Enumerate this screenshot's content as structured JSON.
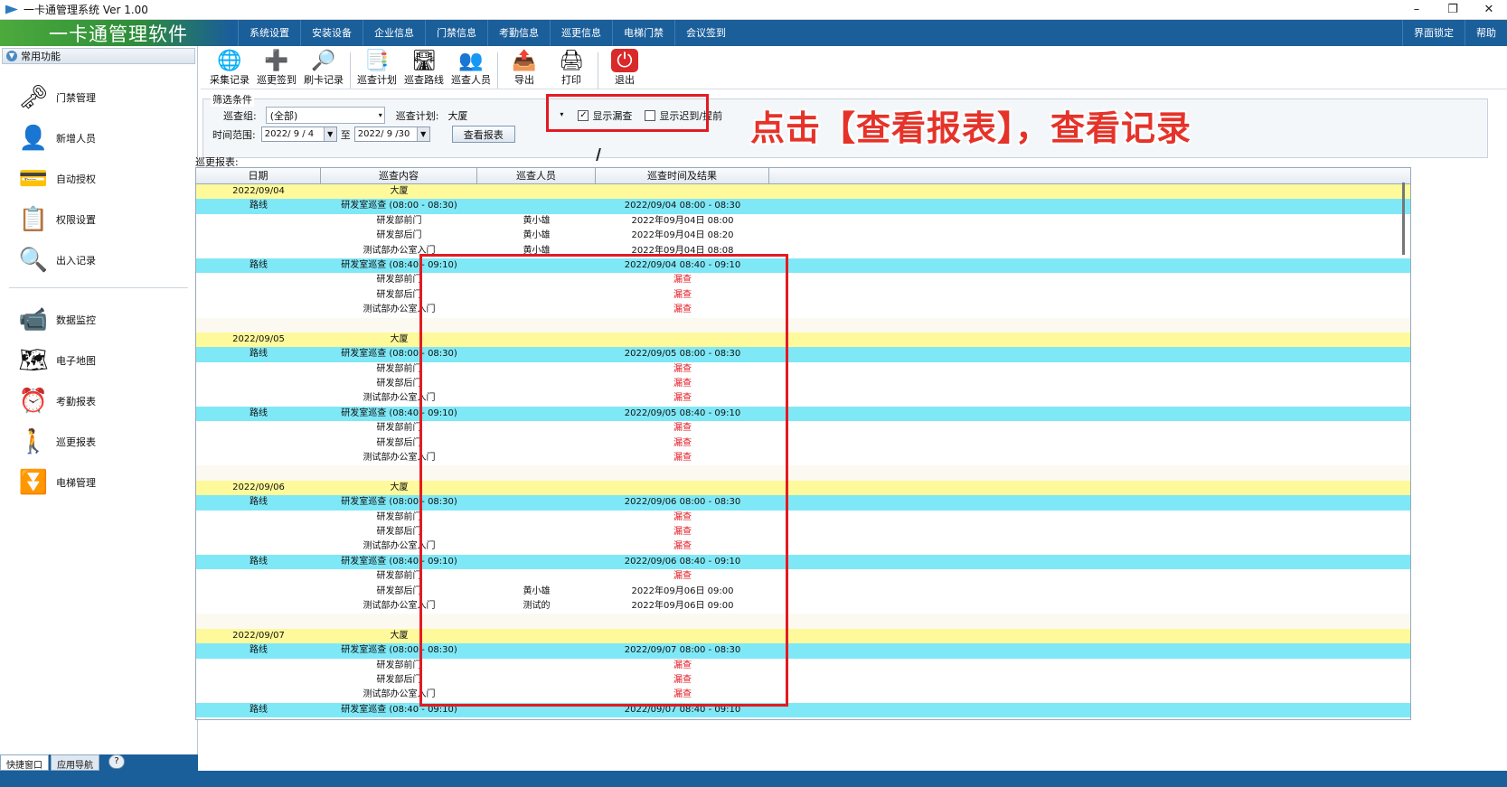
{
  "window": {
    "title": "一卡通管理系统  Ver 1.00",
    "controls": [
      "–",
      "❐",
      "✕"
    ]
  },
  "brand": "一卡通管理软件",
  "menu": [
    "系统设置",
    "安装设备",
    "企业信息",
    "门禁信息",
    "考勤信息",
    "巡更信息",
    "电梯门禁",
    "会议签到"
  ],
  "menu_right": [
    "界面锁定",
    "帮助"
  ],
  "sidebar": {
    "header": "常用功能",
    "group1": [
      {
        "label": "门禁管理",
        "icon": "door-reader-icon"
      },
      {
        "label": "新增人员",
        "icon": "person-icon"
      },
      {
        "label": "自动授权",
        "icon": "card-icon"
      },
      {
        "label": "权限设置",
        "icon": "permission-icon"
      },
      {
        "label": "出入记录",
        "icon": "magnifier-icon"
      }
    ],
    "group2": [
      {
        "label": "数据监控",
        "icon": "camera-icon"
      },
      {
        "label": "电子地图",
        "icon": "map-icon"
      },
      {
        "label": "考勤报表",
        "icon": "clock-icon"
      },
      {
        "label": "巡更报表",
        "icon": "patrol-icon"
      },
      {
        "label": "电梯管理",
        "icon": "elevator-icon"
      }
    ],
    "tabs": [
      "快捷窗口",
      "应用导航"
    ],
    "help": "?"
  },
  "toolbar": [
    {
      "label": "采集记录",
      "icon": "globe-icon"
    },
    {
      "label": "巡更签到",
      "icon": "add-doc-icon"
    },
    {
      "label": "刷卡记录",
      "icon": "search-icon"
    },
    {
      "label": "巡查计划",
      "icon": "plan-icon"
    },
    {
      "label": "巡查路线",
      "icon": "route-icon"
    },
    {
      "label": "巡查人员",
      "icon": "people-icon"
    },
    {
      "label": "导出",
      "icon": "export-icon"
    },
    {
      "label": "打印",
      "icon": "print-icon"
    },
    {
      "label": "退出",
      "icon": "power-icon"
    }
  ],
  "filter": {
    "legend": "筛选条件",
    "group_label": "巡查组:",
    "group_value": "(全部)",
    "plan_label": "巡查计划:",
    "plan_value": "大厦",
    "range_label": "时间范围:",
    "date_from": "2022/ 9 / 4",
    "to": "至",
    "date_to": "2022/ 9 /30",
    "view_button": "查看报表",
    "show_missed": "显示漏查",
    "show_late": "显示迟到/提前"
  },
  "caption": "点击【查看报表】，查看记录",
  "report": {
    "label": "巡更报表:",
    "columns": [
      "日期",
      "巡查内容",
      "巡查人员",
      "巡查时间及结果"
    ],
    "rows": [
      {
        "t": "date",
        "c": [
          "2022/09/04",
          "大厦",
          "",
          ""
        ]
      },
      {
        "t": "route",
        "c": [
          "路线",
          "研发室巡查 (08:00 - 08:30)",
          "",
          "2022/09/04 08:00 - 08:30"
        ]
      },
      {
        "t": "item",
        "c": [
          "",
          "研发部前门",
          "黄小雄",
          "2022年09月04日 08:00"
        ]
      },
      {
        "t": "item",
        "c": [
          "",
          "研发部后门",
          "黄小雄",
          "2022年09月04日 08:20"
        ]
      },
      {
        "t": "item",
        "c": [
          "",
          "测试部办公室入门",
          "黄小雄",
          "2022年09月04日 08:08"
        ]
      },
      {
        "t": "route",
        "c": [
          "路线",
          "研发室巡查 (08:40 - 09:10)",
          "",
          "2022/09/04 08:40 - 09:10"
        ]
      },
      {
        "t": "item",
        "c": [
          "",
          "研发部前门",
          "",
          "漏查"
        ]
      },
      {
        "t": "item",
        "c": [
          "",
          "研发部后门",
          "",
          "漏查"
        ]
      },
      {
        "t": "item",
        "c": [
          "",
          "测试部办公室入门",
          "",
          "漏查"
        ]
      },
      {
        "t": "blank",
        "c": [
          "",
          "",
          "",
          ""
        ]
      },
      {
        "t": "date",
        "c": [
          "2022/09/05",
          "大厦",
          "",
          ""
        ]
      },
      {
        "t": "route",
        "c": [
          "路线",
          "研发室巡查 (08:00 - 08:30)",
          "",
          "2022/09/05 08:00 - 08:30"
        ]
      },
      {
        "t": "item",
        "c": [
          "",
          "研发部前门",
          "",
          "漏查"
        ]
      },
      {
        "t": "item",
        "c": [
          "",
          "研发部后门",
          "",
          "漏查"
        ]
      },
      {
        "t": "item",
        "c": [
          "",
          "测试部办公室入门",
          "",
          "漏查"
        ]
      },
      {
        "t": "route",
        "c": [
          "路线",
          "研发室巡查 (08:40 - 09:10)",
          "",
          "2022/09/05 08:40 - 09:10"
        ]
      },
      {
        "t": "item",
        "c": [
          "",
          "研发部前门",
          "",
          "漏查"
        ]
      },
      {
        "t": "item",
        "c": [
          "",
          "研发部后门",
          "",
          "漏查"
        ]
      },
      {
        "t": "item",
        "c": [
          "",
          "测试部办公室入门",
          "",
          "漏查"
        ]
      },
      {
        "t": "blank",
        "c": [
          "",
          "",
          "",
          ""
        ]
      },
      {
        "t": "date",
        "c": [
          "2022/09/06",
          "大厦",
          "",
          ""
        ]
      },
      {
        "t": "route",
        "c": [
          "路线",
          "研发室巡查 (08:00 - 08:30)",
          "",
          "2022/09/06 08:00 - 08:30"
        ]
      },
      {
        "t": "item",
        "c": [
          "",
          "研发部前门",
          "",
          "漏查"
        ]
      },
      {
        "t": "item",
        "c": [
          "",
          "研发部后门",
          "",
          "漏查"
        ]
      },
      {
        "t": "item",
        "c": [
          "",
          "测试部办公室入门",
          "",
          "漏查"
        ]
      },
      {
        "t": "route",
        "c": [
          "路线",
          "研发室巡查 (08:40 - 09:10)",
          "",
          "2022/09/06 08:40 - 09:10"
        ]
      },
      {
        "t": "item",
        "c": [
          "",
          "研发部前门",
          "",
          "漏查"
        ]
      },
      {
        "t": "item",
        "c": [
          "",
          "研发部后门",
          "黄小雄",
          "2022年09月06日 09:00"
        ]
      },
      {
        "t": "item",
        "c": [
          "",
          "测试部办公室入门",
          "测试的",
          "2022年09月06日 09:00"
        ]
      },
      {
        "t": "blank",
        "c": [
          "",
          "",
          "",
          ""
        ]
      },
      {
        "t": "date",
        "c": [
          "2022/09/07",
          "大厦",
          "",
          ""
        ]
      },
      {
        "t": "route",
        "c": [
          "路线",
          "研发室巡查 (08:00 - 08:30)",
          "",
          "2022/09/07 08:00 - 08:30"
        ]
      },
      {
        "t": "item",
        "c": [
          "",
          "研发部前门",
          "",
          "漏查"
        ]
      },
      {
        "t": "item",
        "c": [
          "",
          "研发部后门",
          "",
          "漏查"
        ]
      },
      {
        "t": "item",
        "c": [
          "",
          "测试部办公室入门",
          "",
          "漏查"
        ]
      },
      {
        "t": "route",
        "c": [
          "路线",
          "研发室巡查 (08:40 - 09:10)",
          "",
          "2022/09/07 08:40 - 09:10"
        ]
      }
    ]
  },
  "colors": {
    "menu_bg": "#1a5e9a",
    "date_row": "#fef99a",
    "route_row": "#7fe8f7",
    "highlight": "#e31b23"
  }
}
